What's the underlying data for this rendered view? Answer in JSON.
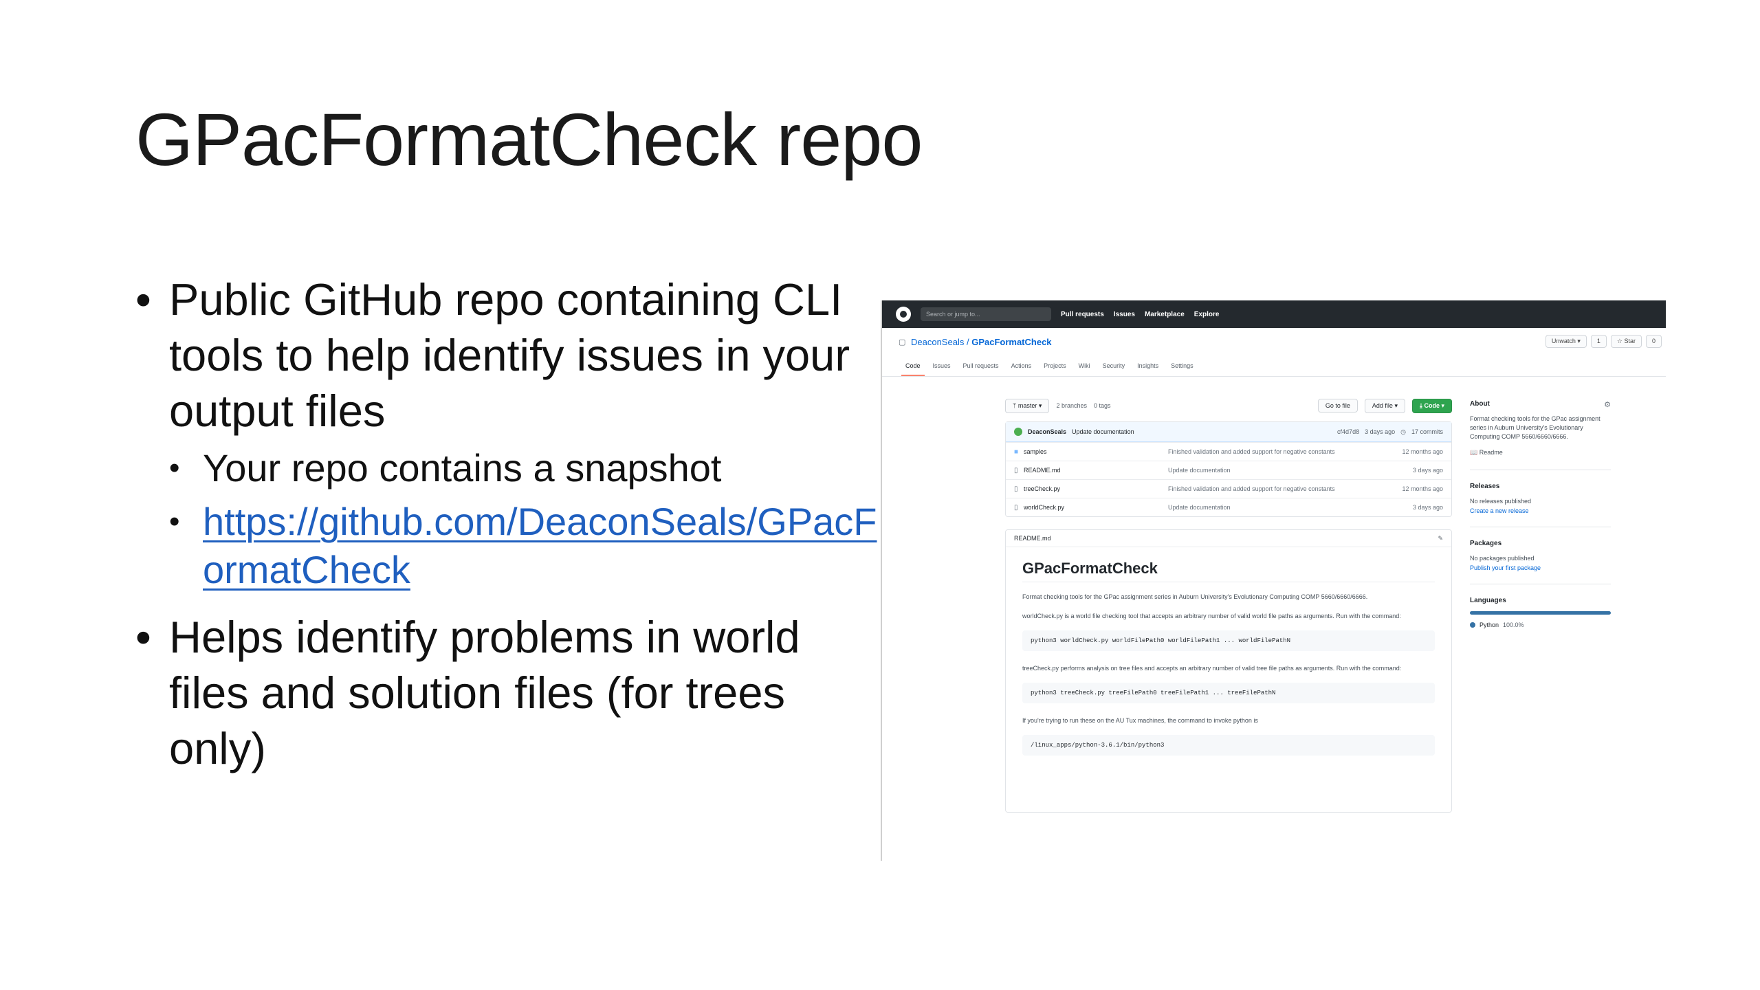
{
  "slide": {
    "title": "GPacFormatCheck repo",
    "bullets": [
      {
        "text": "Public GitHub repo containing CLI tools to help identify issues in your output files",
        "sub": [
          {
            "text": "Your repo contains a snapshot"
          },
          {
            "text": "https://github.com/DeaconSeals/GPacFormatCheck"
          }
        ]
      },
      {
        "text": "Helps identify problems in world files and solution files (for trees only)"
      }
    ],
    "link_color": "#1f5fbf"
  },
  "github": {
    "header": {
      "search_placeholder": "Search or jump to...",
      "nav": [
        "Pull requests",
        "Issues",
        "Marketplace",
        "Explore"
      ]
    },
    "repo": {
      "owner": "DeaconSeals",
      "separator": "/",
      "name": "GPacFormatCheck",
      "unwatch": "Unwatch",
      "watch_count": "1",
      "star": "Star",
      "star_count": "0"
    },
    "tabs": [
      "Code",
      "Issues",
      "Pull requests",
      "Actions",
      "Projects",
      "Wiki",
      "Security",
      "Insights",
      "Settings"
    ],
    "branch": "master",
    "branches": "2 branches",
    "tags": "0 tags",
    "go_to_file": "Go to file",
    "add_file": "Add file",
    "code_button": "Code",
    "last_commit": {
      "author": "DeaconSeals",
      "message": "Update documentation",
      "hash": "cf4d7d8",
      "age": "3 days ago",
      "commits": "17 commits"
    },
    "files": [
      {
        "icon": "folder-icon",
        "name": "samples",
        "message": "Finished validation and added support for negative constants",
        "age": "12 months ago"
      },
      {
        "icon": "file-icon",
        "name": "README.md",
        "message": "Update documentation",
        "age": "3 days ago"
      },
      {
        "icon": "file-icon",
        "name": "treeCheck.py",
        "message": "Finished validation and added support for negative constants",
        "age": "12 months ago"
      },
      {
        "icon": "file-icon",
        "name": "worldCheck.py",
        "message": "Update documentation",
        "age": "3 days ago"
      }
    ],
    "readme": {
      "filename": "README.md",
      "title": "GPacFormatCheck",
      "intro": "Format checking tools for the GPac assignment series in Auburn University's Evolutionary Computing COMP 5660/6660/6666.",
      "world_desc": "worldCheck.py is a world file checking tool that accepts an arbitrary number of valid world file paths as arguments. Run with the command:",
      "world_cmd": "python3 worldCheck.py worldFilePath0 worldFilePath1 ... worldFilePathN",
      "tree_desc": "treeCheck.py performs analysis on tree files and accepts an arbitrary number of valid tree file paths as arguments. Run with the command:",
      "tree_cmd": "python3 treeCheck.py treeFilePath0 treeFilePath1 ... treeFilePathN",
      "tux_desc": "If you're trying to run these on the AU Tux machines, the command to invoke python is",
      "tux_cmd": "/linux_apps/python-3.6.1/bin/python3"
    },
    "about": {
      "heading": "About",
      "description": "Format checking tools for the GPac assignment series in Auburn University's Evolutionary Computing COMP 5660/6660/6666.",
      "readme_link": "Readme"
    },
    "releases": {
      "heading": "Releases",
      "none": "No releases published",
      "link": "Create a new release"
    },
    "packages": {
      "heading": "Packages",
      "none": "No packages published",
      "link": "Publish your first package"
    },
    "languages": {
      "heading": "Languages",
      "items": [
        {
          "name": "Python",
          "percent": "100.0%",
          "color": "#3572A5"
        }
      ]
    }
  }
}
